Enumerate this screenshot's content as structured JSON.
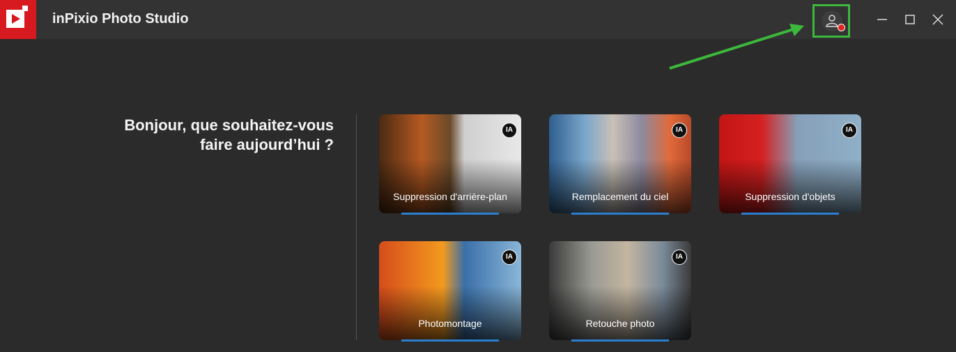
{
  "app": {
    "title": "inPixio Photo Studio",
    "logo": "inpixio-logo"
  },
  "greeting": {
    "line1": "Bonjour, que souhaitez-vous",
    "line2": "faire aujourd’hui ?"
  },
  "cards": [
    {
      "label": "Suppression d'arrière-plan",
      "badge": "IA"
    },
    {
      "label": "Remplacement du ciel",
      "badge": "IA"
    },
    {
      "label": "Suppression d'objets",
      "badge": "IA"
    },
    {
      "label": "Photomontage",
      "badge": "IA"
    },
    {
      "label": "Retouche photo",
      "badge": "IA"
    }
  ],
  "colors": {
    "brand": "#d71920",
    "accent": "#2b7fd0",
    "highlight": "#3cb83c",
    "notification": "#e0261c"
  },
  "icons": [
    "account-icon",
    "minimize-icon",
    "maximize-icon",
    "close-icon",
    "annotation-arrow"
  ]
}
